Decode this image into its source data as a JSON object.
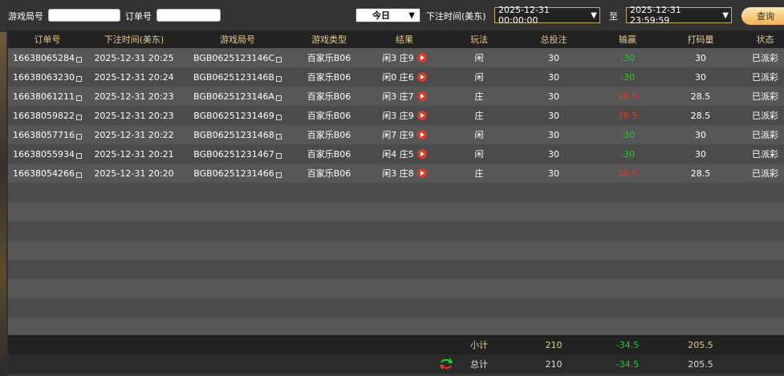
{
  "filters": {
    "game_id_label": "游戏局号",
    "game_id_value": "",
    "order_id_label": "订单号",
    "order_id_value": "",
    "period": "今日",
    "time_label": "下注时间(美东)",
    "start_time": "2025-12-31 00:00:00",
    "to_label": "至",
    "end_time": "2025-12-31 23:59:59",
    "query_label": "查询"
  },
  "table": {
    "headers": [
      "订单号",
      "下注时间(美东)",
      "游戏局号",
      "游戏类型",
      "结果",
      "玩法",
      "总投注",
      "输赢",
      "打码量",
      "状态"
    ],
    "rows": [
      {
        "order": "16638065284",
        "time": "2025-12-31 20:25",
        "game": "BGB0625123146C",
        "type": "百家乐B06",
        "result": "闲3 庄9",
        "play": "闲",
        "bet": "30",
        "win": "-30",
        "turnover": "30",
        "status": "已派彩"
      },
      {
        "order": "16638063230",
        "time": "2025-12-31 20:24",
        "game": "BGB0625123146B",
        "type": "百家乐B06",
        "result": "闲0 庄6",
        "play": "闲",
        "bet": "30",
        "win": "-30",
        "turnover": "30",
        "status": "已派彩"
      },
      {
        "order": "16638061211",
        "time": "2025-12-31 20:23",
        "game": "BGB0625123146A",
        "type": "百家乐B06",
        "result": "闲3 庄7",
        "play": "庄",
        "bet": "30",
        "win": "28.5",
        "turnover": "28.5",
        "status": "已派彩"
      },
      {
        "order": "16638059822",
        "time": "2025-12-31 20:23",
        "game": "BGB0625123146​9",
        "type": "百家乐B06",
        "result": "闲3 庄9",
        "play": "庄",
        "bet": "30",
        "win": "28.5",
        "turnover": "28.5",
        "status": "已派彩"
      },
      {
        "order": "16638057716",
        "time": "2025-12-31 20:22",
        "game": "BGB0625123146​8",
        "type": "百家乐B06",
        "result": "闲7 庄9",
        "play": "闲",
        "bet": "30",
        "win": "-30",
        "turnover": "30",
        "status": "已派彩"
      },
      {
        "order": "16638055934",
        "time": "2025-12-31 20:21",
        "game": "BGB0625123146​7",
        "type": "百家乐B06",
        "result": "闲4 庄5",
        "play": "闲",
        "bet": "30",
        "win": "-30",
        "turnover": "30",
        "status": "已派彩"
      },
      {
        "order": "16638054266",
        "time": "2025-12-31 20:20",
        "game": "BGB0625123146​6",
        "type": "百家乐B06",
        "result": "闲3 庄8",
        "play": "庄",
        "bet": "30",
        "win": "28.5",
        "turnover": "28.5",
        "status": "已派彩"
      }
    ],
    "subtotal": {
      "label": "小计",
      "bet": "210",
      "win": "-34.5",
      "turnover": "205.5"
    },
    "total": {
      "label": "总计",
      "bet": "210",
      "win": "-34.5",
      "turnover": "205.5"
    }
  },
  "colors": {
    "loss": "#1dd31d",
    "win": "#e23a2a",
    "header_text": "#e8c98e"
  }
}
